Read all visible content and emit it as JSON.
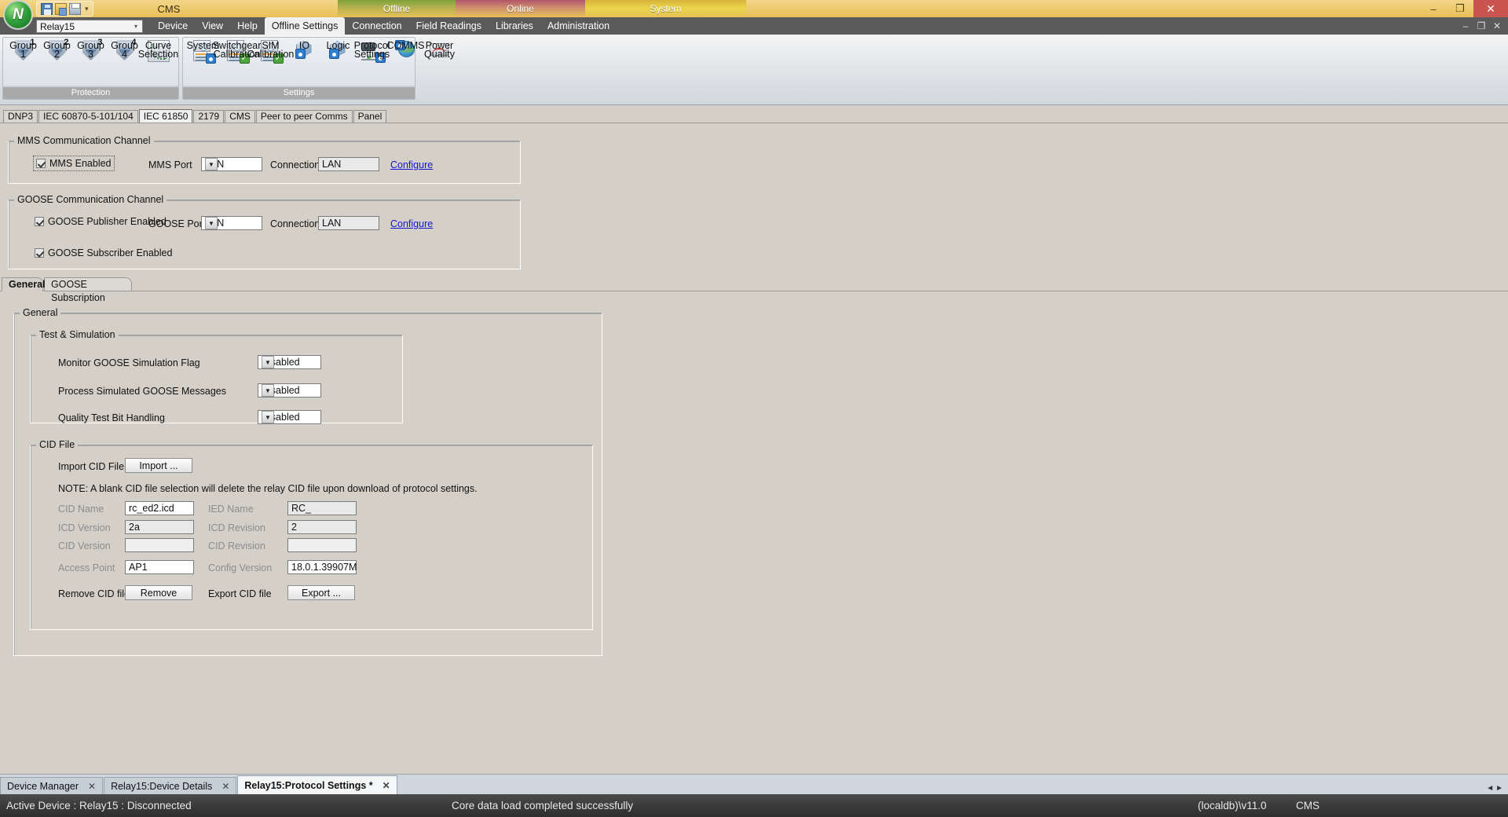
{
  "titlebar": {
    "app_title": "CMS",
    "segments": [
      {
        "label": "Offline",
        "name": "title-segment-offline"
      },
      {
        "label": "Online",
        "name": "title-segment-online"
      },
      {
        "label": "System",
        "name": "title-segment-system"
      }
    ],
    "quick_access": [
      "save-icon",
      "open-icon",
      "print-preview-icon"
    ],
    "qat_caret": "▾",
    "window_buttons": {
      "minimize": "–",
      "restore": "❐",
      "close": "✕"
    },
    "orb_glyph": "N"
  },
  "menubar": {
    "device_selector": {
      "value": "Relay15",
      "caret": "▾"
    },
    "items": [
      {
        "label": "Device",
        "active": false
      },
      {
        "label": "View",
        "active": false
      },
      {
        "label": "Help",
        "active": false
      },
      {
        "label": "Offline Settings",
        "active": true
      },
      {
        "label": "Connection",
        "active": false
      },
      {
        "label": "Field Readings",
        "active": false
      },
      {
        "label": "Libraries",
        "active": false
      },
      {
        "label": "Administration",
        "active": false
      }
    ],
    "inner_window_buttons": {
      "minimize": "–",
      "restore": "❐",
      "close": "✕"
    }
  },
  "ribbon": {
    "groups": [
      {
        "title": "Protection",
        "items": [
          {
            "label_lines": [
              "Group",
              "1"
            ],
            "icon": "shield-1-icon",
            "badge": "1"
          },
          {
            "label_lines": [
              "Group",
              "2"
            ],
            "icon": "shield-2-icon",
            "badge": "2"
          },
          {
            "label_lines": [
              "Group",
              "3"
            ],
            "icon": "shield-3-icon",
            "badge": "3"
          },
          {
            "label_lines": [
              "Group",
              "4"
            ],
            "icon": "shield-4-icon",
            "badge": "4"
          },
          {
            "label_lines": [
              "Curve",
              "Selection"
            ],
            "icon": "curve-selection-icon",
            "badge": ""
          }
        ]
      },
      {
        "title": "Settings",
        "items": [
          {
            "label_lines": [
              "System"
            ],
            "icon": "system-settings-icon",
            "badge": ""
          },
          {
            "label_lines": [
              "Switchgear",
              "Calibration"
            ],
            "icon": "switchgear-calibration-icon",
            "badge": ""
          },
          {
            "label_lines": [
              "SIM",
              "Calibration"
            ],
            "icon": "sim-calibration-icon",
            "badge": ""
          },
          {
            "label_lines": [
              "IO"
            ],
            "icon": "io-icon",
            "badge": ""
          },
          {
            "label_lines": [
              "Logic"
            ],
            "icon": "logic-icon",
            "badge": ""
          },
          {
            "label_lines": [
              "Protocol",
              "Settings"
            ],
            "icon": "protocol-settings-icon",
            "badge": ""
          },
          {
            "label_lines": [
              "COMMS"
            ],
            "icon": "comms-icon",
            "badge": ""
          },
          {
            "label_lines": [
              "Power",
              "Quality"
            ],
            "icon": "power-quality-icon",
            "badge": ""
          }
        ]
      }
    ]
  },
  "protocol_tabs": [
    {
      "label": "DNP3",
      "active": false
    },
    {
      "label": "IEC 60870-5-101/104",
      "active": false
    },
    {
      "label": "IEC 61850",
      "active": true
    },
    {
      "label": "2179",
      "active": false
    },
    {
      "label": "CMS",
      "active": false
    },
    {
      "label": "Peer to peer Comms",
      "active": false
    },
    {
      "label": "Panel",
      "active": false
    }
  ],
  "mms_group": {
    "legend": "MMS Communication Channel",
    "enabled_checkbox": {
      "label": "MMS Enabled",
      "checked": true
    },
    "port_label": "MMS Port",
    "port_value": "LAN",
    "connection_label": "Connection",
    "connection_value": "LAN",
    "configure_link": "Configure"
  },
  "goose_group": {
    "legend": "GOOSE Communication Channel",
    "publisher_checkbox": {
      "label": "GOOSE Publisher Enabled",
      "checked": true
    },
    "subscriber_checkbox": {
      "label": "GOOSE Subscriber Enabled",
      "checked": true
    },
    "port_label": "GOOSE Port",
    "port_value": "LAN",
    "connection_label": "Connection",
    "connection_value": "LAN",
    "configure_link": "Configure"
  },
  "inner_tabs": [
    {
      "label": "General",
      "active": true
    },
    {
      "label": "GOOSE Subscription",
      "active": false
    }
  ],
  "general_group": {
    "legend": "General",
    "test_simulation": {
      "legend": "Test & Simulation",
      "rows": [
        {
          "label": "Monitor GOOSE Simulation Flag",
          "value": "Disabled"
        },
        {
          "label": "Process Simulated GOOSE Messages",
          "value": "Disabled"
        },
        {
          "label": "Quality Test Bit Handling",
          "value": "Disabled"
        }
      ]
    },
    "cid_file": {
      "legend": "CID File",
      "import_label": "Import CID File",
      "import_button": "Import ...",
      "note": "NOTE: A blank CID file selection will delete the relay CID file upon download of protocol settings.",
      "fields": [
        {
          "label": "CID Name",
          "value": "rc_ed2.icd",
          "dim_label": true,
          "empty": false
        },
        {
          "label": "IED Name",
          "value": "RC_",
          "dim_label": true,
          "empty": false
        },
        {
          "label": "ICD Version",
          "value": "2a",
          "dim_label": true,
          "empty": false
        },
        {
          "label": "ICD Revision",
          "value": "2",
          "dim_label": true,
          "empty": false
        },
        {
          "label": "CID Version",
          "value": "",
          "dim_label": true,
          "empty": true
        },
        {
          "label": "CID Revision",
          "value": "",
          "dim_label": true,
          "empty": true
        },
        {
          "label": "Access Point",
          "value": "AP1",
          "dim_label": true,
          "empty": false
        },
        {
          "label": "Config Version",
          "value": "18.0.1.39907M",
          "dim_label": true,
          "empty": false
        }
      ],
      "remove_label": "Remove CID file",
      "remove_button": "Remove",
      "export_label": "Export CID file",
      "export_button": "Export ..."
    }
  },
  "doc_tabs": [
    {
      "label": "Device Manager",
      "active": false,
      "close": "✕"
    },
    {
      "label": "Relay15:Device Details",
      "active": false,
      "close": "✕"
    },
    {
      "label": "Relay15:Protocol Settings *",
      "active": true,
      "close": "✕"
    }
  ],
  "doc_nav": {
    "prev": "◄",
    "next": "►"
  },
  "statusbar": {
    "active_device": "Active Device : Relay15 : Disconnected",
    "message": "Core data load completed successfully",
    "database": "(localdb)\\v11.0",
    "app": "CMS"
  },
  "colors": {
    "title_gold": "#e8c058",
    "offline_green": "#7fa23a",
    "online_red": "#b2566a",
    "system_yellow": "#e9d54a",
    "close_red": "#c9534f",
    "link_blue": "#1414cf",
    "dialog_gray": "#d4d0c8",
    "status_dark": "#3b3b3b"
  }
}
